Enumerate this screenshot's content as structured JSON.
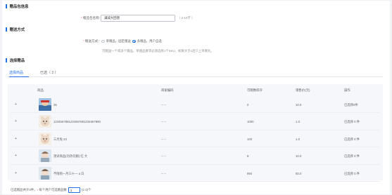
{
  "sections": {
    "basic": "赠品包信息",
    "method": "赠送方式",
    "choose": "选择赠品"
  },
  "name_field": {
    "label": "赠品包名称：",
    "value": "满减大回馈",
    "hint": "（ 2-10字 ）"
  },
  "method": {
    "label": "赠送方式：",
    "options": [
      "单赠品，固定赠送",
      "多赠品，用户自选"
    ],
    "selected_index": 1,
    "hint": "可赠送一个或多个赠品，单赠品要求必须选择1个SKU，如果大于1后只上单赠允。"
  },
  "tabs": {
    "goods": "选择商品",
    "selected": "已选（ 2 ）",
    "active_index": 0
  },
  "table": {
    "headers": [
      "商品",
      "商家编码",
      "可赠数库存",
      "销售价(元)",
      "操作"
    ],
    "rows": [
      {
        "name": "25",
        "code": "-- --",
        "stock": "0",
        "price": "10.0",
        "action": "已选择0件"
      },
      {
        "name": "1234567891234567891234567890",
        "code": "-- --",
        "stock": "1000",
        "price": "1.0",
        "action": "已选择 0 件"
      },
      {
        "name": "三月兔 23",
        "code": "-- --",
        "stock": "100",
        "price": "1.0",
        "action": "已选择 0 件"
      },
      {
        "name": "测试商品(勿改勿删) 红 大",
        "code": "-- --",
        "stock": "8",
        "price": "10.0",
        "action": "已选择 0 件"
      },
      {
        "name": "不限购一月三十一 a 白",
        "code": "-- --",
        "stock": "894",
        "price": "50.0",
        "action": "已选择 0 件"
      }
    ]
  },
  "footer": {
    "prefix": "已选赠品共计2件，",
    "label": "每个用户可选赠品数",
    "value": "1",
    "suffix": "(1-2)个"
  },
  "colors": {
    "accent": "#1f6feb",
    "required": "#f56c6c"
  }
}
